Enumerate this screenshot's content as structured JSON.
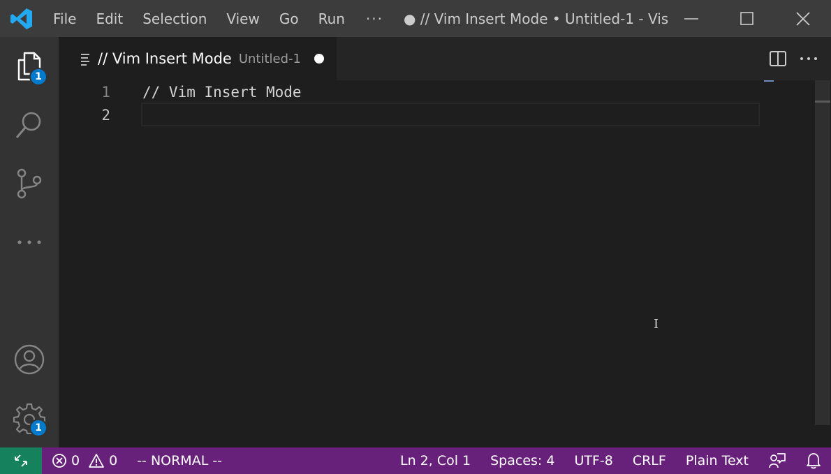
{
  "titlebar": {
    "menu": [
      "File",
      "Edit",
      "Selection",
      "View",
      "Go",
      "Run"
    ],
    "more": "···",
    "window_title": "● // Vim Insert Mode • Untitled-1 - Vis..."
  },
  "activitybar": {
    "explorer_badge": "1",
    "settings_badge": "1"
  },
  "tab": {
    "label": "// Vim Insert Mode",
    "description": "Untitled-1"
  },
  "editor": {
    "lines": [
      {
        "number": "1",
        "text": "// Vim Insert Mode"
      },
      {
        "number": "2",
        "text": ""
      }
    ]
  },
  "statusbar": {
    "errors": "0",
    "warnings": "0",
    "vim_mode": "-- NORMAL --",
    "position": "Ln 2, Col 1",
    "indent": "Spaces: 4",
    "encoding": "UTF-8",
    "eol": "CRLF",
    "language": "Plain Text"
  },
  "colors": {
    "statusbar": "#68217a",
    "remote": "#16825d",
    "badge": "#007acc",
    "accent_logo": "#23a9f2"
  }
}
